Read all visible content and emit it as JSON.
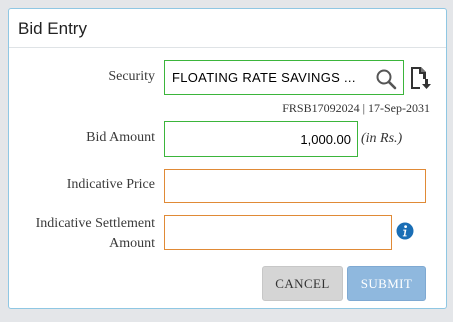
{
  "dialog": {
    "title": "Bid Entry",
    "security": {
      "label": "Security",
      "value": "FLOATING RATE SAVINGS ...",
      "hint": "FRSB17092024 | 17-Sep-2031",
      "search_icon": "search-icon",
      "details_icon": "document-download-icon"
    },
    "bid_amount": {
      "label": "Bid Amount",
      "value": "1,000.00",
      "unit": "(in Rs.)"
    },
    "indicative_price": {
      "label": "Indicative Price",
      "value": ""
    },
    "settlement": {
      "label_line1": "Indicative Settlement",
      "label_line2": "Amount",
      "value": "",
      "info_icon": "info-icon"
    },
    "buttons": {
      "cancel": "CANCEL",
      "submit": "SUBMIT"
    }
  },
  "colors": {
    "valid_border": "#3bb53b",
    "pending_border": "#e08a36",
    "submit_bg": "#8fb8de",
    "cancel_bg": "#d5d5d5",
    "info_icon": "#1a6eb5"
  }
}
